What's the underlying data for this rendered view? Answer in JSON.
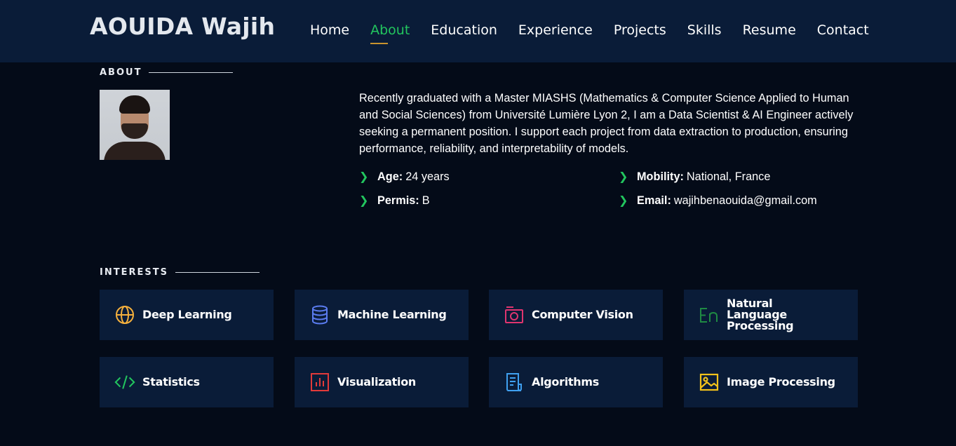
{
  "header": {
    "logo": "AOUIDA Wajih",
    "nav": [
      "Home",
      "About",
      "Education",
      "Experience",
      "Projects",
      "Skills",
      "Resume",
      "Contact"
    ],
    "active_nav": "About"
  },
  "about": {
    "section_title": "ABOUT",
    "bio": "Recently graduated with a Master MIASHS (Mathematics & Computer Science Applied to Human and Social Sciences) from Université Lumière Lyon 2, I am a Data Scientist & AI Engineer actively seeking a permanent position. I support each project from data extraction to production, ensuring performance, reliability, and interpretability of models.",
    "details": [
      {
        "label": "Age:",
        "value": "24 years"
      },
      {
        "label": "Mobility:",
        "value": "National, France"
      },
      {
        "label": "Permis:",
        "value": "B"
      },
      {
        "label": "Email:",
        "value": "wajihbenaouida@gmail.com"
      }
    ]
  },
  "interests": {
    "section_title": "INTERESTS",
    "items": [
      {
        "label": "Deep Learning",
        "icon": "globe-icon",
        "color": "#f5b03d"
      },
      {
        "label": "Machine Learning",
        "icon": "database-icon",
        "color": "#5b7cf0"
      },
      {
        "label": "Computer Vision",
        "icon": "camera-icon",
        "color": "#e0356f"
      },
      {
        "label": "Natural Language Processing",
        "icon": "language-icon",
        "color": "#1f8a43"
      },
      {
        "label": "Statistics",
        "icon": "code-icon",
        "color": "#22c55e"
      },
      {
        "label": "Visualization",
        "icon": "bar-chart-icon",
        "color": "#e23a3a"
      },
      {
        "label": "Algorithms",
        "icon": "document-icon",
        "color": "#3fa0f0"
      },
      {
        "label": "Image Processing",
        "icon": "image-icon",
        "color": "#f2c21b"
      }
    ]
  },
  "colors": {
    "background": "#040b18",
    "header_bg": "#0a1c38",
    "accent_green": "#22c55e",
    "underline": "#c9932e"
  }
}
